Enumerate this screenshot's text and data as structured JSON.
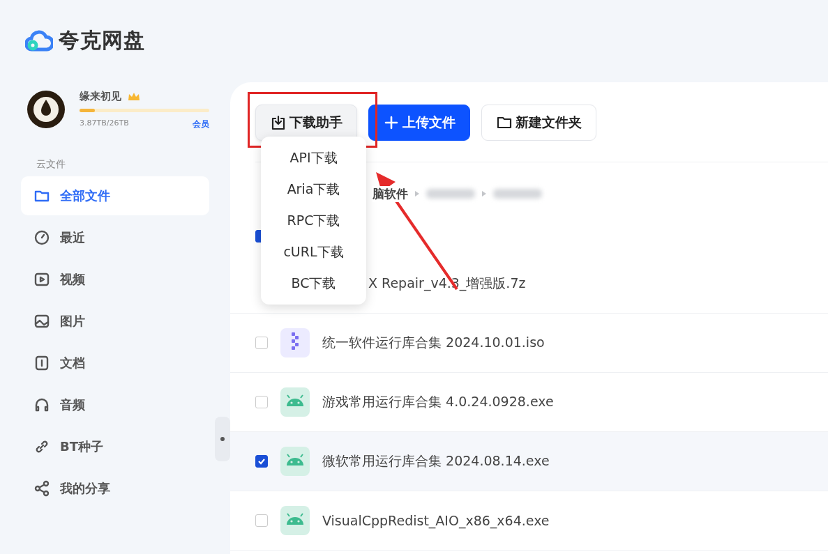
{
  "app": {
    "name": "夸克网盘"
  },
  "user": {
    "name": "缘来初见",
    "storage": "3.87TB/26TB",
    "link": "会员",
    "level": 0.12
  },
  "sidebar": {
    "section": "云文件",
    "items": [
      {
        "label": "全部文件",
        "selected": true
      },
      {
        "label": "最近",
        "selected": false
      },
      {
        "label": "视频",
        "selected": false
      },
      {
        "label": "图片",
        "selected": false
      },
      {
        "label": "文档",
        "selected": false
      },
      {
        "label": "音频",
        "selected": false
      },
      {
        "label": "BT种子",
        "selected": false
      },
      {
        "label": "我的分享",
        "selected": false
      }
    ]
  },
  "toolbar": {
    "buttons": [
      {
        "label": "下载助手",
        "kind": "download"
      },
      {
        "label": "上传文件",
        "kind": "upload"
      },
      {
        "label": "新建文件夹",
        "kind": "folder"
      }
    ]
  },
  "annotation": {
    "highlight_box": true,
    "arrow": true
  },
  "dropdown": {
    "items": [
      "API下载",
      "Aria下载",
      "RPC下载",
      "cURL下载",
      "BC下载"
    ]
  },
  "breadcrumb": [
    {
      "label": "脑软件",
      "kind": "text"
    },
    {
      "kind": "blurred"
    },
    {
      "kind": "blurred"
    }
  ],
  "select_all": {
    "checked": true
  },
  "files": [
    {
      "name": "X Repair_v4.3_增强版.7z",
      "kind": "covered"
    },
    {
      "name": "统一软件运行库合集 2024.10.01.iso",
      "kind": "iso",
      "checked": false
    },
    {
      "name": "游戏常用运行库合集 4.0.24.0928.exe",
      "kind": "exe",
      "checked": false
    },
    {
      "name": "微软常用运行库合集 2024.08.14.exe",
      "kind": "exe",
      "checked": true
    },
    {
      "name": "VisualCppRedist_AIO_x86_x64.exe",
      "kind": "exe",
      "checked": false
    }
  ]
}
